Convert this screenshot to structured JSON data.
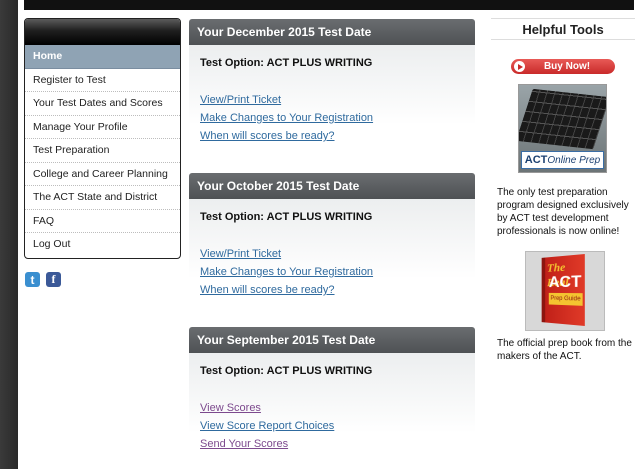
{
  "nav": {
    "items": [
      {
        "label": "Home",
        "active": true
      },
      {
        "label": "Register to Test"
      },
      {
        "label": "Your Test Dates and Scores"
      },
      {
        "label": "Manage Your Profile"
      },
      {
        "label": "Test Preparation"
      },
      {
        "label": "College and Career Planning"
      },
      {
        "label": "The ACT State and District"
      },
      {
        "label": "FAQ"
      },
      {
        "label": "Log Out"
      }
    ]
  },
  "social": {
    "twitter_icon": "twitter-icon",
    "twitter_glyph": "t",
    "facebook_icon": "facebook-icon",
    "facebook_glyph": "f"
  },
  "panels": [
    {
      "title": "Your December 2015 Test Date",
      "option": "Test Option: ACT PLUS WRITING",
      "links": [
        "View/Print Ticket",
        "Make Changes to Your Registration",
        "When will scores be ready?"
      ]
    },
    {
      "title": "Your October 2015 Test Date",
      "option": "Test Option: ACT PLUS WRITING",
      "links": [
        "View/Print Ticket",
        "Make Changes to Your Registration",
        "When will scores be ready?"
      ]
    },
    {
      "title": "Your September 2015 Test Date",
      "option": "Test Option: ACT PLUS WRITING",
      "links": [
        "View Scores",
        "View Score Report Choices",
        "Send Your Scores"
      ]
    }
  ],
  "tools": {
    "title": "Helpful Tools",
    "buy_label": "Buy Now!",
    "prep_logo_brand": "ACT",
    "prep_logo_product": "Online Prep",
    "prep_desc": "The only test preparation program designed exclusively by ACT test development professionals is now online!",
    "book_title_real": "The Real",
    "book_title_act": "ACT",
    "book_subtitle": "Prep Guide",
    "book_desc": "The official prep book from the makers of the ACT."
  },
  "colors": {
    "link": "#2f6a9e",
    "link_visited": "#7d4a8e",
    "nav_active": "#8fa3b4",
    "panel_header": "#54575a",
    "buy_button": "#d43a36"
  }
}
